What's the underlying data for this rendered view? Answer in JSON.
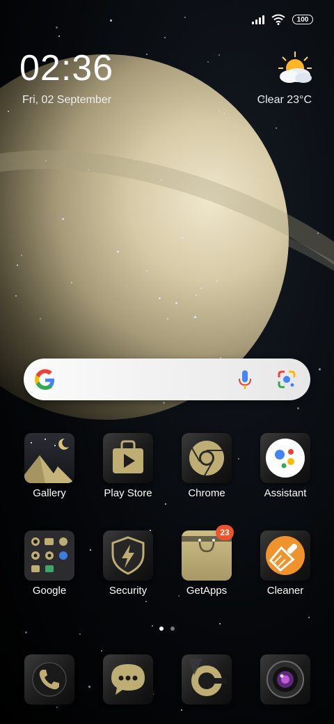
{
  "status_bar": {
    "battery": "100"
  },
  "clock": {
    "time": "02:36",
    "date": "Fri, 02 September"
  },
  "weather": {
    "text": "Clear  23°C",
    "icon": "sun-cloud-icon"
  },
  "search": {
    "mic_icon": "mic-icon",
    "lens_icon": "lens-icon"
  },
  "apps_row1": [
    {
      "label": "Gallery",
      "icon": "gallery-icon"
    },
    {
      "label": "Play Store",
      "icon": "play-store-icon"
    },
    {
      "label": "Chrome",
      "icon": "chrome-icon"
    },
    {
      "label": "Assistant",
      "icon": "assistant-icon"
    }
  ],
  "apps_row2": [
    {
      "label": "Google",
      "icon": "google-folder-icon"
    },
    {
      "label": "Security",
      "icon": "security-icon"
    },
    {
      "label": "GetApps",
      "icon": "getapps-icon",
      "badge": "23"
    },
    {
      "label": "Cleaner",
      "icon": "cleaner-icon"
    }
  ],
  "dock": [
    {
      "icon": "phone-icon"
    },
    {
      "icon": "messages-icon"
    },
    {
      "icon": "browser-icon"
    },
    {
      "icon": "camera-icon"
    }
  ],
  "page_indicator": {
    "count": 2,
    "active": 0
  },
  "colors": {
    "gold": "#bfae73",
    "badge": "#f0532c",
    "cleaner": "#f0932c"
  }
}
